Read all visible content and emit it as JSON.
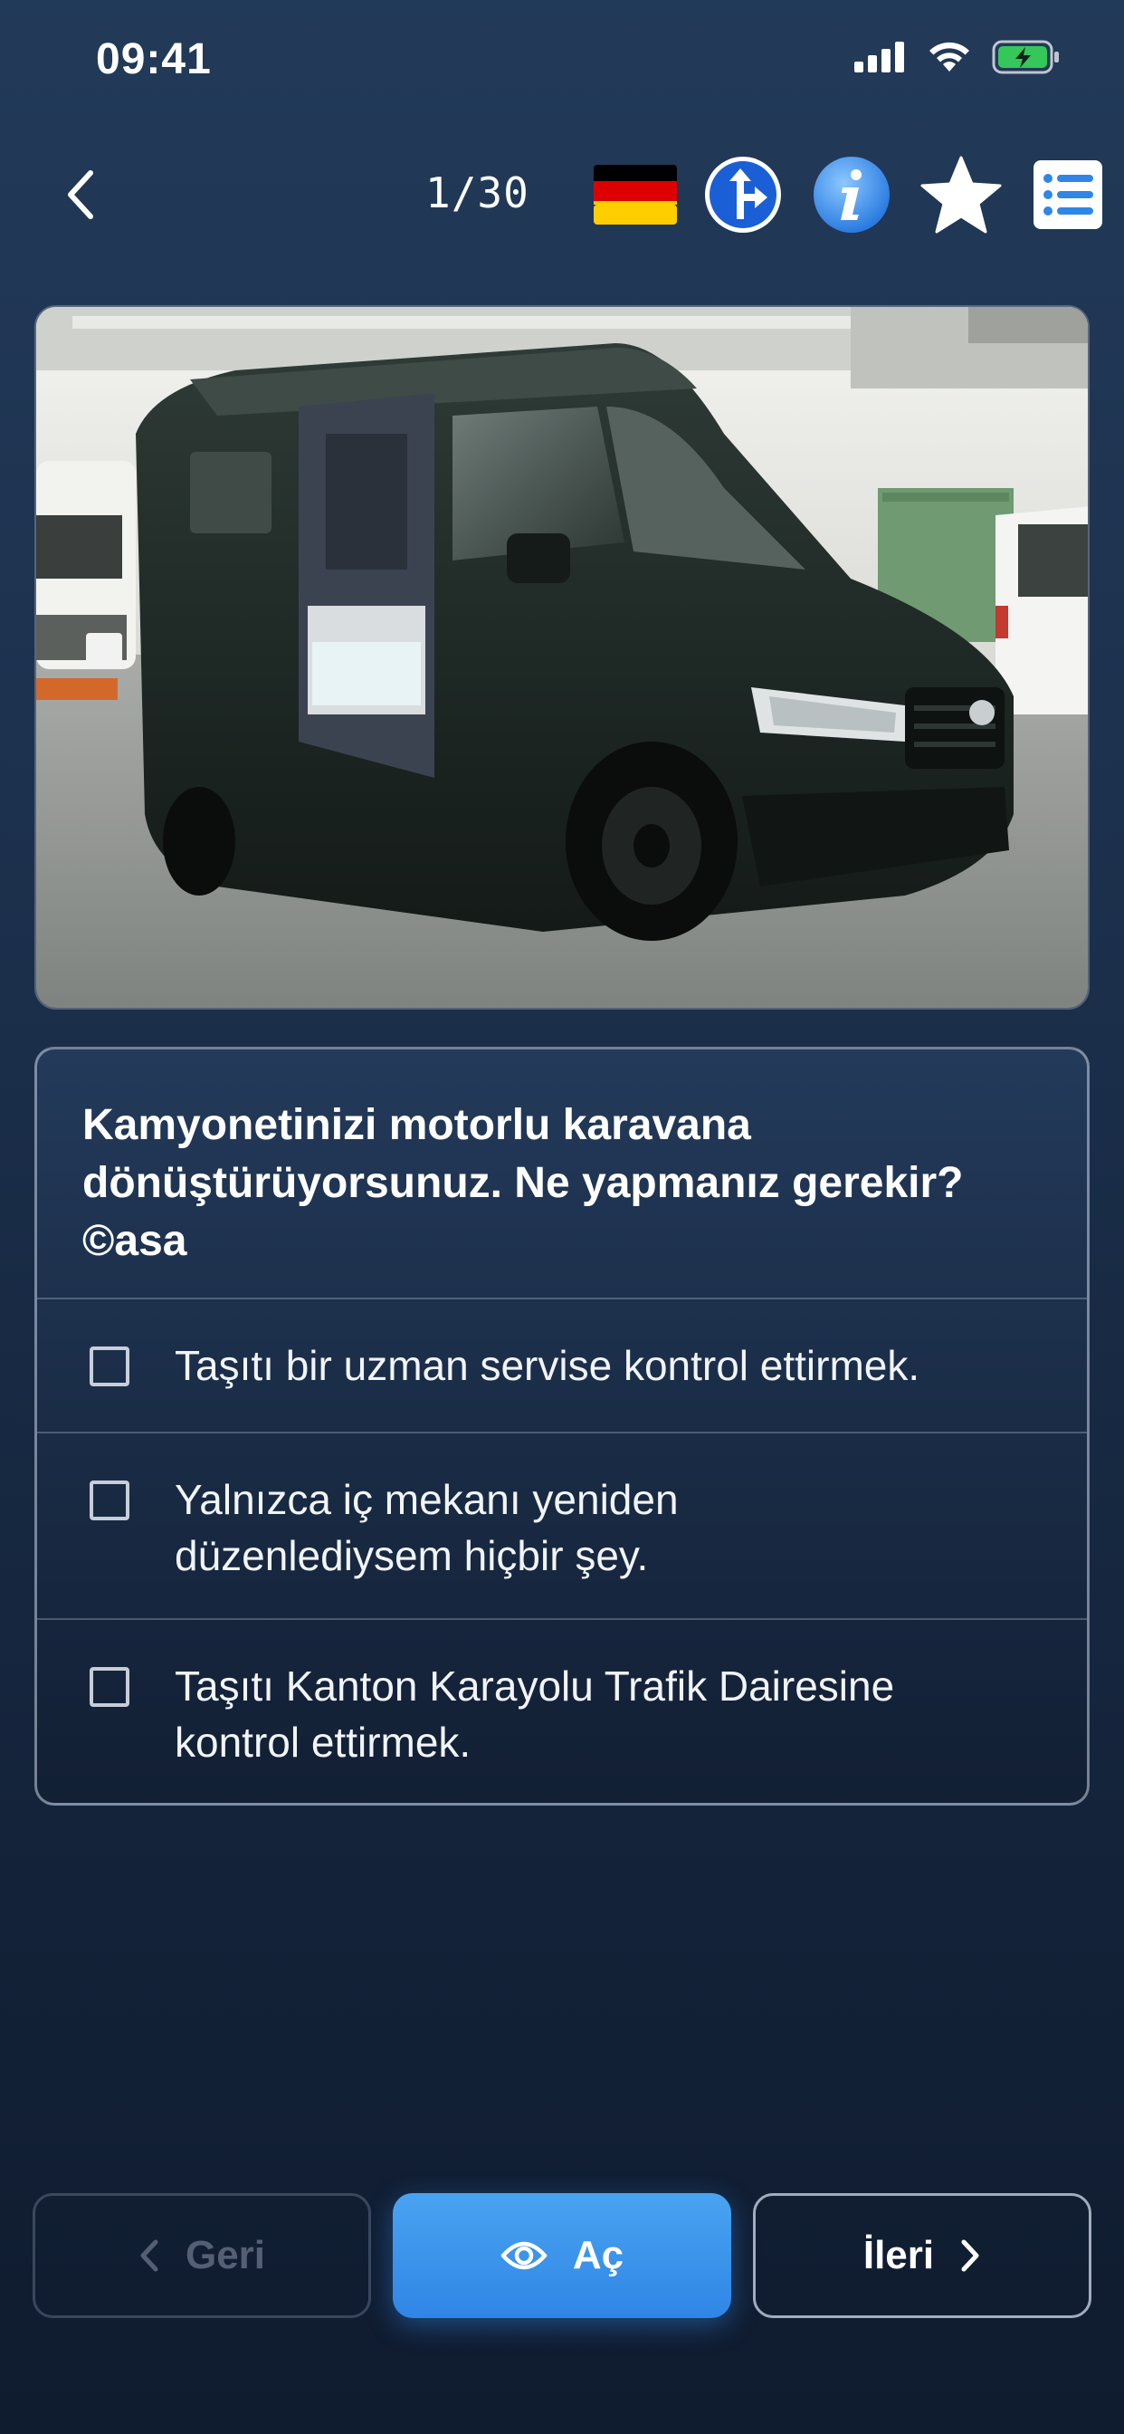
{
  "status_bar": {
    "time": "09:41"
  },
  "nav": {
    "counter": "1/30",
    "icons": [
      "back-icon",
      "german-flag-icon",
      "road-sign-icon",
      "info-icon",
      "star-icon",
      "list-icon"
    ]
  },
  "question": {
    "text": "Kamyonetinizi motorlu karavana dönüştürüyorsunuz. Ne yapmanız gerekir? ©asa",
    "options": [
      {
        "label": "Taşıtı bir uzman servise kontrol ettirmek.",
        "checked": false
      },
      {
        "label": "Yalnızca iç mekanı yeniden düzenlediysem hiçbir şey.",
        "checked": false
      },
      {
        "label": "Taşıtı Kanton Karayolu Trafik Dairesine kontrol ettirmek.",
        "checked": false
      }
    ]
  },
  "footer": {
    "prev_label": "Geri",
    "open_label": "Aç",
    "next_label": "İleri"
  },
  "colors": {
    "accent": "#2f86e6",
    "background": "#1b2f4b"
  }
}
